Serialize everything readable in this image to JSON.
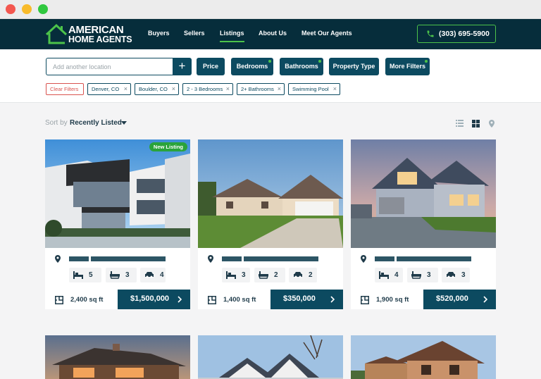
{
  "nav": {
    "logo_line1": "AMERICAN",
    "logo_line2": "HOME AGENTS",
    "links": [
      "Buyers",
      "Sellers",
      "Listings",
      "About Us",
      "Meet Our Agents"
    ],
    "active_link": "Listings",
    "phone": "(303) 695-5900"
  },
  "search": {
    "placeholder": "Add another location",
    "add_label": "+"
  },
  "filters": {
    "buttons": [
      "Price",
      "Bedrooms",
      "Bathrooms",
      "Property Type",
      "More Filters"
    ],
    "clear_label": "Clear Filters",
    "chips": [
      "Denver, CO",
      "Boulder, CO",
      "2 - 3 Bedrooms",
      "2+ Bathrooms",
      "Swimming Pool"
    ],
    "chip_close": "×"
  },
  "sort": {
    "label": "Sort by",
    "value": "Recently Listed"
  },
  "listings": [
    {
      "badge": "New Listing",
      "beds": "5",
      "baths": "3",
      "garage": "4",
      "sqft": "2,400 sq ft",
      "price": "$1,500,000"
    },
    {
      "badge": "",
      "beds": "3",
      "baths": "2",
      "garage": "2",
      "sqft": "1,400 sq ft",
      "price": "$350,000"
    },
    {
      "badge": "",
      "beds": "4",
      "baths": "3",
      "garage": "3",
      "sqft": "1,900 sq ft",
      "price": "$520,000"
    }
  ],
  "colors": {
    "navy": "#062d3b",
    "primary": "#0c4a60",
    "accent": "#4cc34a",
    "danger": "#d9534f"
  }
}
